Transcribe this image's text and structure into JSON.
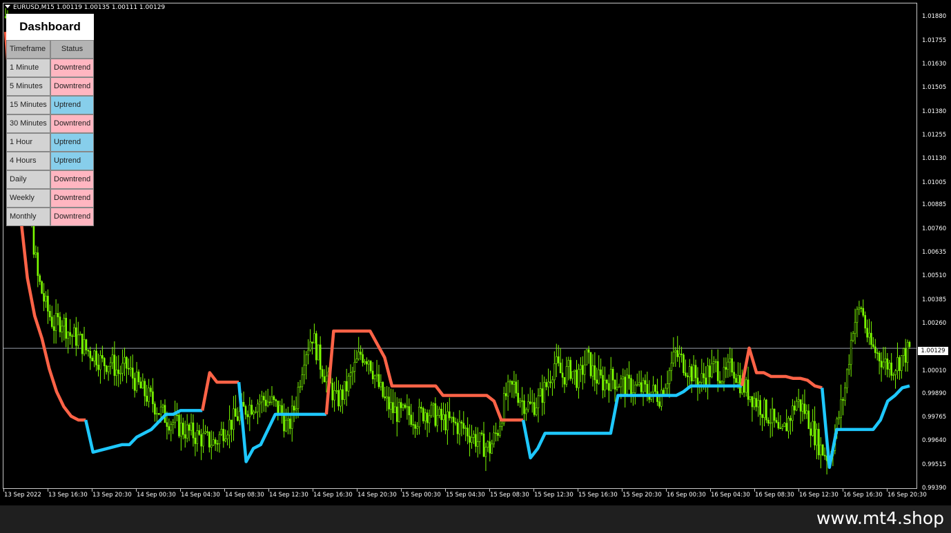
{
  "symbol_header": "EURUSD,M15  1.00119 1.00135 1.00111 1.00129",
  "watermark": "www.mt4.shop",
  "current_price": "1.00129",
  "colors": {
    "background": "#000000",
    "candles": "#7cfc00",
    "downtrend_line": "#ff6347",
    "uptrend_line": "#1ec8ff",
    "downtrend_cell": "#ffb6c1",
    "uptrend_cell": "#87ceeb"
  },
  "dashboard": {
    "title": "Dashboard",
    "headers": {
      "timeframe": "Timeframe",
      "status": "Status"
    },
    "rows": [
      {
        "timeframe": "1 Minute",
        "status": "Downtrend"
      },
      {
        "timeframe": "5 Minutes",
        "status": "Downtrend"
      },
      {
        "timeframe": "15 Minutes",
        "status": "Uptrend"
      },
      {
        "timeframe": "30 Minutes",
        "status": "Downtrend"
      },
      {
        "timeframe": "1 Hour",
        "status": "Uptrend"
      },
      {
        "timeframe": "4 Hours",
        "status": "Uptrend"
      },
      {
        "timeframe": "Daily",
        "status": "Downtrend"
      },
      {
        "timeframe": "Weekly",
        "status": "Downtrend"
      },
      {
        "timeframe": "Monthly",
        "status": "Downtrend"
      }
    ]
  },
  "chart_data": {
    "type": "candlestick",
    "symbol": "EURUSD",
    "timeframe": "M15",
    "price_ticks": [
      "1.01880",
      "1.01755",
      "1.01630",
      "1.01505",
      "1.01380",
      "1.01255",
      "1.01130",
      "1.01005",
      "1.00885",
      "1.00760",
      "1.00635",
      "1.00510",
      "1.00385",
      "1.00260",
      "1.00129",
      "1.00010",
      "0.99890",
      "0.99765",
      "0.99640",
      "0.99515",
      "0.99390"
    ],
    "time_ticks": [
      "13 Sep 2022",
      "13 Sep 16:30",
      "13 Sep 20:30",
      "14 Sep 00:30",
      "14 Sep 04:30",
      "14 Sep 08:30",
      "14 Sep 12:30",
      "14 Sep 16:30",
      "14 Sep 20:30",
      "15 Sep 00:30",
      "15 Sep 04:30",
      "15 Sep 08:30",
      "15 Sep 12:30",
      "15 Sep 16:30",
      "15 Sep 20:30",
      "16 Sep 00:30",
      "16 Sep 04:30",
      "16 Sep 08:30",
      "16 Sep 12:30",
      "16 Sep 16:30",
      "16 Sep 20:30"
    ],
    "ylim": [
      0.9939,
      1.0195
    ],
    "close_series": [
      [
        0,
        1.0188
      ],
      [
        1,
        1.016
      ],
      [
        2,
        1.0125
      ],
      [
        3,
        1.0085
      ],
      [
        4,
        1.005
      ],
      [
        5,
        1.0035
      ],
      [
        6,
        1.0025
      ],
      [
        7,
        1.0028
      ],
      [
        8,
        1.002
      ],
      [
        9,
        1.0018
      ],
      [
        10,
        1.0012
      ],
      [
        11,
        1.001
      ],
      [
        12,
        1.0005
      ],
      [
        13,
        1.0006
      ],
      [
        14,
        1.0
      ],
      [
        15,
        1.0003
      ],
      [
        16,
        0.9996
      ],
      [
        17,
        0.999
      ],
      [
        18,
        0.9986
      ],
      [
        19,
        0.998
      ],
      [
        20,
        0.9976
      ],
      [
        21,
        0.9973
      ],
      [
        22,
        0.997
      ],
      [
        23,
        0.9968
      ],
      [
        24,
        0.9966
      ],
      [
        25,
        0.9964
      ],
      [
        26,
        0.9963
      ],
      [
        27,
        0.997
      ],
      [
        28,
        0.9974
      ],
      [
        29,
        0.9978
      ],
      [
        30,
        0.9982
      ],
      [
        31,
        0.9984
      ],
      [
        32,
        0.9986
      ],
      [
        33,
        0.9984
      ],
      [
        34,
        0.998
      ],
      [
        35,
        0.997
      ],
      [
        36,
        0.9985
      ],
      [
        37,
        1.001
      ],
      [
        38,
        1.002
      ],
      [
        39,
        1.0005
      ],
      [
        40,
        0.9995
      ],
      [
        41,
        0.9985
      ],
      [
        42,
        0.999
      ],
      [
        43,
        1.0
      ],
      [
        44,
        1.001
      ],
      [
        45,
        1.0008
      ],
      [
        46,
        0.9995
      ],
      [
        47,
        0.9985
      ],
      [
        48,
        0.998
      ],
      [
        49,
        0.9978
      ],
      [
        50,
        0.9978
      ],
      [
        51,
        0.9976
      ],
      [
        52,
        0.998
      ],
      [
        53,
        0.9978
      ],
      [
        54,
        0.9975
      ],
      [
        55,
        0.9974
      ],
      [
        56,
        0.9972
      ],
      [
        57,
        0.997
      ],
      [
        58,
        0.9966
      ],
      [
        59,
        0.9962
      ],
      [
        60,
        0.996
      ],
      [
        61,
        0.997
      ],
      [
        62,
        0.9988
      ],
      [
        63,
        0.9993
      ],
      [
        64,
        0.9985
      ],
      [
        65,
        0.9982
      ],
      [
        66,
        0.9985
      ],
      [
        67,
        0.9993
      ],
      [
        68,
        1.0005
      ],
      [
        69,
        0.9998
      ],
      [
        70,
        1.0002
      ],
      [
        71,
        0.9996
      ],
      [
        72,
        1.0008
      ],
      [
        73,
        0.9998
      ],
      [
        74,
        0.9995
      ],
      [
        75,
        0.9997
      ],
      [
        76,
        0.9995
      ],
      [
        77,
        0.9993
      ],
      [
        78,
        0.9992
      ],
      [
        79,
        0.9991
      ],
      [
        80,
        0.999
      ],
      [
        81,
        0.9988
      ],
      [
        82,
        0.9998
      ],
      [
        83,
        1.001
      ],
      [
        84,
        1.0005
      ],
      [
        85,
        1.0
      ],
      [
        86,
        0.9995
      ],
      [
        87,
        1.0
      ],
      [
        88,
        1.0003
      ],
      [
        89,
        0.9997
      ],
      [
        90,
        1.0004
      ],
      [
        91,
        0.9995
      ],
      [
        92,
        0.999
      ],
      [
        93,
        0.9985
      ],
      [
        94,
        0.998
      ],
      [
        95,
        0.9975
      ],
      [
        96,
        0.9965
      ],
      [
        97,
        0.9975
      ],
      [
        98,
        0.9985
      ],
      [
        99,
        0.998
      ],
      [
        100,
        0.997
      ],
      [
        101,
        0.996
      ],
      [
        102,
        0.9955
      ],
      [
        103,
        0.9972
      ],
      [
        104,
        0.9992
      ],
      [
        105,
        1.0025
      ],
      [
        106,
        1.0035
      ],
      [
        107,
        1.0015
      ],
      [
        108,
        1.001
      ],
      [
        109,
        1.0005
      ],
      [
        110,
        1.0003
      ],
      [
        111,
        1.0008
      ],
      [
        112,
        1.0012
      ]
    ],
    "indicator_segments": [
      {
        "trend": "down",
        "points": [
          [
            0,
            1.018
          ],
          [
            1,
            1.013
          ],
          [
            2,
            1.0085
          ],
          [
            3,
            1.005
          ],
          [
            4,
            1.003
          ],
          [
            5,
            1.0018
          ],
          [
            6,
            1.0002
          ],
          [
            7,
            0.999
          ],
          [
            8,
            0.9982
          ],
          [
            9,
            0.9977
          ],
          [
            10,
            0.9975
          ],
          [
            11,
            0.9975
          ]
        ]
      },
      {
        "trend": "up",
        "points": [
          [
            11,
            0.9975
          ],
          [
            12,
            0.9958
          ],
          [
            13,
            0.9959
          ],
          [
            14,
            0.996
          ],
          [
            15,
            0.9961
          ],
          [
            16,
            0.9962
          ],
          [
            17,
            0.9962
          ],
          [
            18,
            0.9966
          ],
          [
            19,
            0.9968
          ],
          [
            20,
            0.997
          ],
          [
            21,
            0.9974
          ],
          [
            22,
            0.9978
          ],
          [
            23,
            0.9978
          ],
          [
            24,
            0.998
          ],
          [
            25,
            0.998
          ],
          [
            26,
            0.998
          ],
          [
            27,
            0.998
          ]
        ]
      },
      {
        "trend": "down",
        "points": [
          [
            27,
            0.998
          ],
          [
            28,
            1.0
          ],
          [
            29,
            0.9995
          ],
          [
            30,
            0.9995
          ],
          [
            31,
            0.9995
          ],
          [
            32,
            0.9995
          ]
        ]
      },
      {
        "trend": "up",
        "points": [
          [
            32,
            0.9995
          ],
          [
            33,
            0.9953
          ],
          [
            34,
            0.996
          ],
          [
            35,
            0.9962
          ],
          [
            36,
            0.997
          ],
          [
            37,
            0.9978
          ],
          [
            38,
            0.9978
          ],
          [
            39,
            0.9978
          ],
          [
            40,
            0.9978
          ],
          [
            41,
            0.9978
          ],
          [
            42,
            0.9978
          ],
          [
            43,
            0.9978
          ],
          [
            44,
            0.9978
          ]
        ]
      },
      {
        "trend": "down",
        "points": [
          [
            44,
            0.9978
          ],
          [
            45,
            1.0022
          ],
          [
            46,
            1.0022
          ],
          [
            47,
            1.0022
          ],
          [
            48,
            1.0022
          ],
          [
            49,
            1.0022
          ],
          [
            50,
            1.0022
          ],
          [
            51,
            1.0015
          ],
          [
            52,
            1.0008
          ],
          [
            53,
            0.9993
          ],
          [
            54,
            0.9993
          ],
          [
            55,
            0.9993
          ],
          [
            56,
            0.9993
          ],
          [
            57,
            0.9993
          ],
          [
            58,
            0.9993
          ],
          [
            59,
            0.9993
          ],
          [
            60,
            0.9988
          ],
          [
            61,
            0.9988
          ],
          [
            62,
            0.9988
          ],
          [
            63,
            0.9988
          ],
          [
            64,
            0.9988
          ],
          [
            65,
            0.9988
          ],
          [
            66,
            0.9988
          ],
          [
            67,
            0.9985
          ],
          [
            68,
            0.9975
          ],
          [
            69,
            0.9975
          ],
          [
            70,
            0.9975
          ],
          [
            71,
            0.9975
          ]
        ]
      },
      {
        "trend": "up",
        "points": [
          [
            71,
            0.9975
          ],
          [
            72,
            0.9955
          ],
          [
            73,
            0.996
          ],
          [
            74,
            0.9968
          ],
          [
            75,
            0.9968
          ],
          [
            76,
            0.9968
          ],
          [
            77,
            0.9968
          ],
          [
            78,
            0.9968
          ],
          [
            79,
            0.9968
          ],
          [
            80,
            0.9968
          ],
          [
            81,
            0.9968
          ],
          [
            82,
            0.9968
          ],
          [
            83,
            0.9968
          ],
          [
            84,
            0.9988
          ],
          [
            85,
            0.9988
          ],
          [
            86,
            0.9988
          ],
          [
            87,
            0.9988
          ],
          [
            88,
            0.9988
          ],
          [
            89,
            0.9988
          ],
          [
            90,
            0.9988
          ],
          [
            91,
            0.9988
          ],
          [
            92,
            0.9988
          ],
          [
            93,
            0.999
          ],
          [
            94,
            0.9993
          ],
          [
            95,
            0.9993
          ],
          [
            96,
            0.9993
          ],
          [
            97,
            0.9993
          ],
          [
            98,
            0.9993
          ],
          [
            99,
            0.9993
          ],
          [
            100,
            0.9993
          ],
          [
            101,
            0.9993
          ]
        ]
      },
      {
        "trend": "down",
        "points": [
          [
            101,
            0.9993
          ],
          [
            102,
            1.0013
          ],
          [
            103,
            1.0
          ],
          [
            104,
            1.0
          ],
          [
            105,
            0.9998
          ],
          [
            106,
            0.9998
          ],
          [
            107,
            0.9998
          ],
          [
            108,
            0.9997
          ],
          [
            109,
            0.9997
          ],
          [
            110,
            0.9996
          ],
          [
            111,
            0.9993
          ],
          [
            112,
            0.9992
          ]
        ]
      },
      {
        "trend": "up",
        "points": [
          [
            112,
            0.9992
          ],
          [
            113,
            0.995
          ],
          [
            114,
            0.997
          ],
          [
            115,
            0.997
          ],
          [
            116,
            0.997
          ],
          [
            117,
            0.997
          ],
          [
            118,
            0.997
          ],
          [
            119,
            0.997
          ],
          [
            120,
            0.9975
          ],
          [
            121,
            0.9985
          ],
          [
            122,
            0.9988
          ],
          [
            123,
            0.9992
          ],
          [
            124,
            0.9993
          ]
        ]
      }
    ]
  }
}
